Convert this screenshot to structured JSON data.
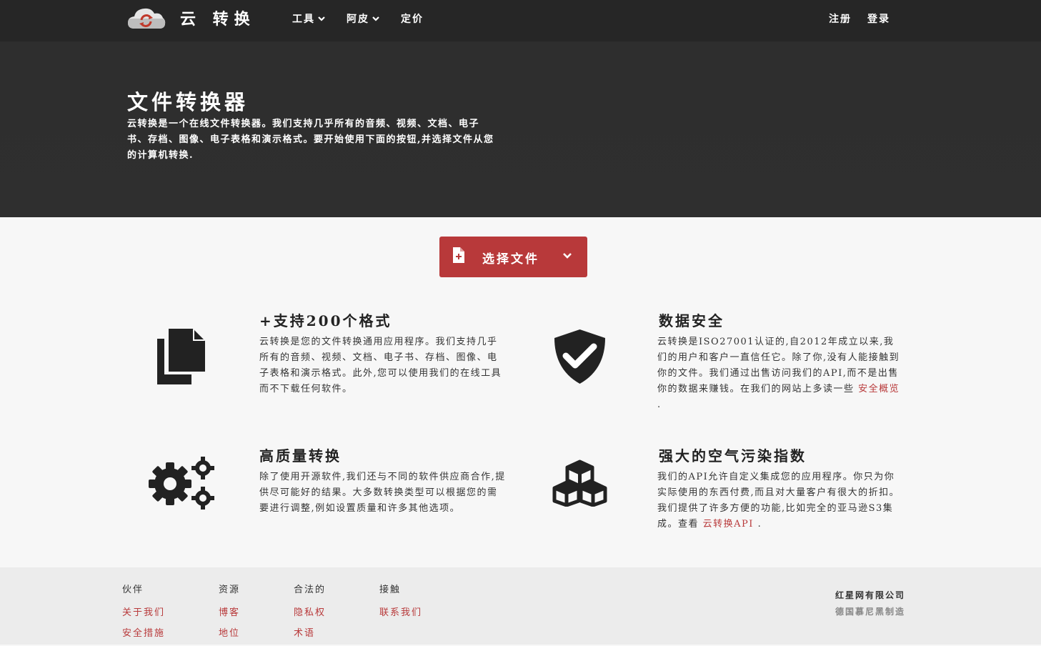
{
  "header": {
    "brand": "云 转换",
    "nav": {
      "tools": "工具",
      "skin": "阿皮",
      "pricing": "定价",
      "signup": "注册",
      "login": "登录"
    }
  },
  "hero": {
    "title": "文件转换器",
    "description": "云转换是一个在线文件转换器。我们支持几乎所有的音频、视频、文档、电子书、存档、图像、电子表格和演示格式。要开始使用下面的按钮,并选择文件从您的计算机转换."
  },
  "select_button": {
    "label": "选择文件"
  },
  "features": [
    {
      "icon": "files-icon",
      "title": "+支持200个格式",
      "text": "云转换是您的文件转换通用应用程序。我们支持几乎所有的音频、视频、文档、电子书、存档、图像、电子表格和演示格式。此外,您可以使用我们的在线工具而不下载任何软件。"
    },
    {
      "icon": "shield-check-icon",
      "title": "数据安全",
      "text": "云转换是ISO27001认证的,自2012年成立以来,我们的用户和客户一直信任它。除了你,没有人能接触到你的文件。我们通过出售访问我们的API,而不是出售你的数据来赚钱。在我们的网站上多读一些",
      "link": "安全概览",
      "suffix": "."
    },
    {
      "icon": "gears-icon",
      "title": "高质量转换",
      "text": "除了使用开源软件,我们还与不同的软件供应商合作,提供尽可能好的结果。大多数转换类型可以根据您的需要进行调整,例如设置质量和许多其他选项。"
    },
    {
      "icon": "cubes-icon",
      "title": "强大的空气污染指数",
      "text": "我们的API允许自定义集成您的应用程序。你只为你实际使用的东西付费,而且对大量客户有很大的折扣。我们提供了许多方便的功能,比如完全的亚马逊S3集成。查看",
      "link": "云转换API",
      "suffix": "."
    }
  ],
  "footer": {
    "columns": [
      {
        "heading": "伙伴",
        "links": [
          "关于我们",
          "安全措施"
        ]
      },
      {
        "heading": "资源",
        "links": [
          "博客",
          "地位"
        ]
      },
      {
        "heading": "合法的",
        "links": [
          "隐私权",
          "术语"
        ]
      },
      {
        "heading": "接触",
        "links": [
          "联系我们"
        ]
      }
    ],
    "company": "红星网有限公司",
    "made_in": "德国慕尼黑制造"
  },
  "colors": {
    "accent": "#b8393a",
    "hero_bg": "#2e2e2e",
    "page_bg": "#f7f7f7",
    "footer_bg": "#ececec"
  }
}
